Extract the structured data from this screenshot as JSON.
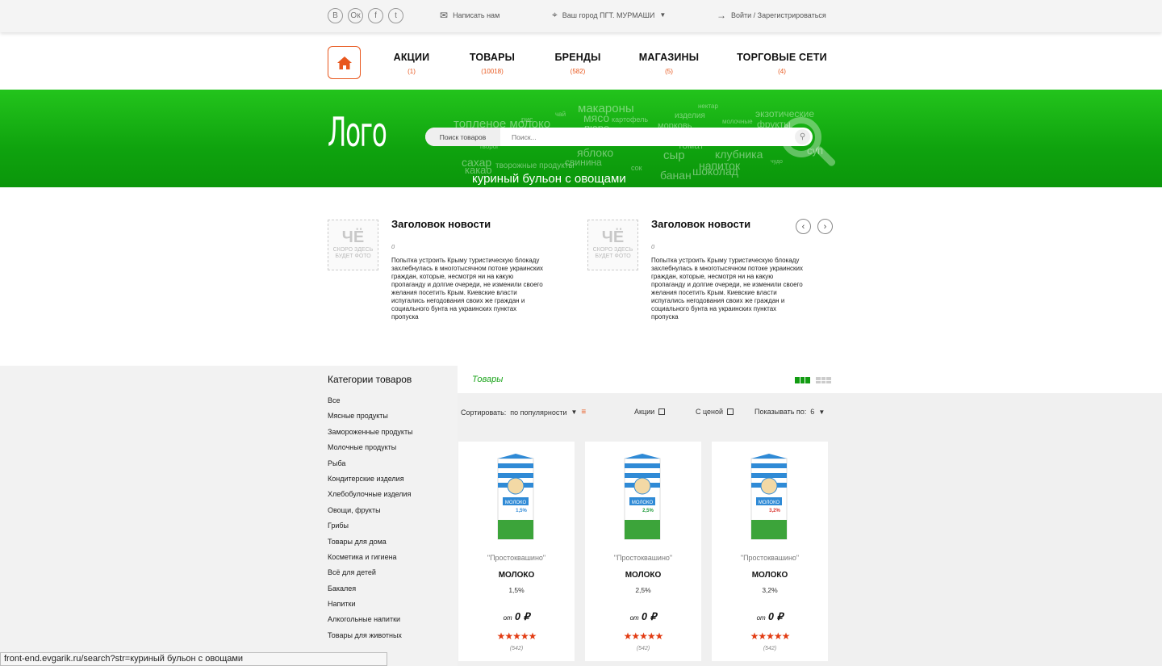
{
  "topbar": {
    "social": [
      "В",
      "Ок",
      "f",
      "t"
    ],
    "write_us": "Написать нам",
    "city": "Ваш город ПГТ. МУРМАШИ",
    "login": "Войти / Зарегистрироваться"
  },
  "nav": {
    "items": [
      {
        "label": "АКЦИИ",
        "count": "(1)"
      },
      {
        "label": "ТОВАРЫ",
        "count": "(10018)"
      },
      {
        "label": "БРЕНДЫ",
        "count": "(582)"
      },
      {
        "label": "МАГАЗИНЫ",
        "count": "(5)"
      },
      {
        "label": "ТОРГОВЫЕ СЕТИ",
        "count": "(4)"
      }
    ]
  },
  "banner": {
    "logo": "Лого",
    "search_category": "Поиск товаров",
    "search_placeholder": "Поиск...",
    "cloud": [
      "макароны",
      "мясо",
      "пюре",
      "топленое молоко",
      "изделия",
      "нектар",
      "экзотические",
      "фрукты",
      "морковь",
      "картофель",
      "молочные",
      "чай",
      "рис",
      "яблоко",
      "сыр",
      "клубника",
      "напиток",
      "шоколад",
      "сахар",
      "какао",
      "творожные продукты",
      "свинина",
      "сок",
      "банан",
      "томат",
      "суп",
      "чудо",
      "творог",
      "куриный бульон с овощами"
    ]
  },
  "news": [
    {
      "title": "Заголовок новости",
      "date": "0",
      "photo_mark": "ЧЁ",
      "photo_caption": "СКОРО ЗДЕСЬ БУДЕТ ФОТО",
      "text": "Попытка устроить Крыму туристическую блокаду захлебнулась в многотысячном потоке украинских граждан, которые, несмотря ни на какую пропаганду и долгие очереди, не изменили своего желания посетить Крым. Киевские власти испугались негодования своих же граждан и социального бунта на украинских пунктах пропуска"
    },
    {
      "title": "Заголовок новости",
      "date": "0",
      "photo_mark": "ЧЁ",
      "photo_caption": "СКОРО ЗДЕСЬ БУДЕТ ФОТО",
      "text": "Попытка устроить Крыму туристическую блокаду захлебнулась в многотысячном потоке украинских граждан, которые, несмотря ни на какую пропаганду и долгие очереди, не изменили своего желания посетить Крым. Киевские власти испугались негодования своих же граждан и социального бунта на украинских пунктах пропуска"
    }
  ],
  "categories": {
    "title": "Категории товаров",
    "items": [
      "Все",
      "Мясные продукты",
      "Замороженные продукты",
      "Молочные продукты",
      "Рыба",
      "Кондитерские изделия",
      "Хлебобулочные изделия",
      "Овощи, фрукты",
      "Грибы",
      "Товары для дома",
      "Косметика и гигиена",
      "Всё для детей",
      "Бакалея",
      "Напитки",
      "Алкогольные напитки",
      "Товары для животных"
    ]
  },
  "goods": {
    "title": "Товары",
    "sort_label": "Сортировать:",
    "sort_value": "по популярности",
    "promo_label": "Акции",
    "price_label": "С ценой",
    "show_label": "Показывать по:",
    "show_value": "6",
    "products": [
      {
        "brand": "\"Простоквашино\"",
        "name": "МОЛОКО",
        "fat": "1,5%",
        "price_from": "от",
        "price": "0 ₽",
        "stars": "★★★★★",
        "votes": "(542)",
        "pack_label": "1,5%",
        "pack_color": "#2f8ad6"
      },
      {
        "brand": "\"Простоквашино\"",
        "name": "МОЛОКО",
        "fat": "2,5%",
        "price_from": "от",
        "price": "0 ₽",
        "stars": "★★★★★",
        "votes": "(542)",
        "pack_label": "2,5%",
        "pack_color": "#1e9a3a"
      },
      {
        "brand": "\"Простоквашино\"",
        "name": "МОЛОКО",
        "fat": "3,2%",
        "price_from": "от",
        "price": "0 ₽",
        "stars": "★★★★★",
        "votes": "(542)",
        "pack_label": "3,2%",
        "pack_color": "#d8322c"
      }
    ]
  },
  "statusbar": "front-end.evgarik.ru/search?str=куриный бульон с овощами",
  "colors": {
    "accent": "#e8571d",
    "green": "#129c12"
  }
}
